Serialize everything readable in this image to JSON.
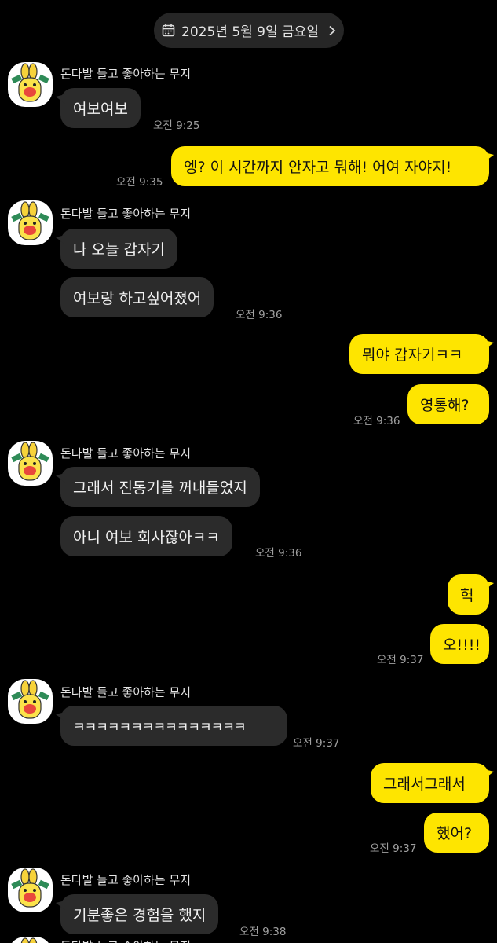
{
  "date_pill": {
    "label": "2025년 5월 9일 금요일"
  },
  "sender_name": "돈다발 들고 좋아하는 무지",
  "messages": [
    {
      "text": "여보여보",
      "time": "오전 9:25"
    },
    {
      "text": "엥? 이 시간까지 안자고 뭐해! 어여 자야지!",
      "time": "오전 9:35"
    },
    {
      "text": "나 오늘 갑자기"
    },
    {
      "text": "여보랑 하고싶어졌어",
      "time": "오전 9:36"
    },
    {
      "text": "뭐야 갑자기ㅋㅋ"
    },
    {
      "text": "영통해?",
      "time": "오전 9:36"
    },
    {
      "text": "그래서 진동기를 꺼내들었지"
    },
    {
      "text": "아니 여보 회사잖아ㅋㅋ",
      "time": "오전 9:36"
    },
    {
      "text": "헉"
    },
    {
      "text": "오!!!!",
      "time": "오전 9:37"
    },
    {
      "text": "ㅋㅋㅋㅋㅋㅋㅋㅋㅋㅋㅋㅋㅋㅋㅋ",
      "time": "오전 9:37"
    },
    {
      "text": "그래서그래서"
    },
    {
      "text": "했어?",
      "time": "오전 9:37"
    },
    {
      "text": "기분좋은 경험을 했지",
      "time": "오전 9:38"
    }
  ],
  "colors": {
    "incoming_bubble": "#2b2b2b",
    "outgoing_bubble": "#fee500",
    "background": "#000000"
  },
  "icons": {
    "date": "calendar-icon",
    "date_chevron": "chevron-right-icon",
    "avatar": "muzi-avatar"
  }
}
